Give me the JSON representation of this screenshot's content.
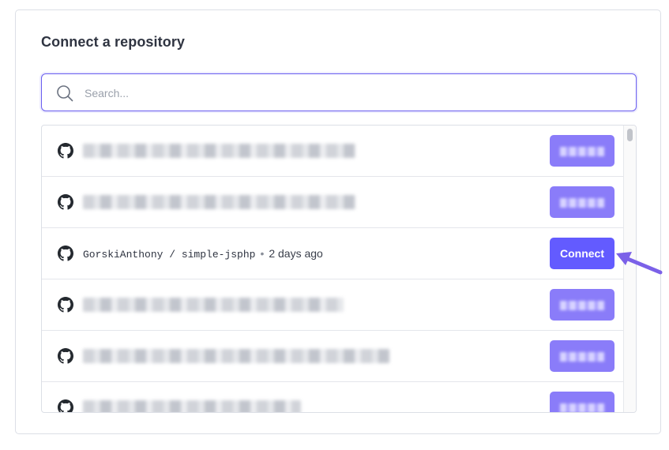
{
  "title": "Connect a repository",
  "search": {
    "placeholder": "Search...",
    "value": "",
    "icon": "search-icon"
  },
  "repositories": [
    {
      "visible": false,
      "button_label": ""
    },
    {
      "visible": false,
      "button_label": ""
    },
    {
      "visible": true,
      "name": "GorskiAnthony / simple-jsphp",
      "separator": "•",
      "updated": "2 days ago",
      "button_label": "Connect"
    },
    {
      "visible": false,
      "button_label": ""
    },
    {
      "visible": false,
      "button_label": ""
    },
    {
      "visible": false,
      "button_label": ""
    }
  ],
  "colors": {
    "accent": "#635bff",
    "annotation_arrow": "#7b61e8",
    "border": "#dcdfe6"
  },
  "icons": {
    "repo_icon": "github-icon",
    "annotation": "arrow-icon"
  }
}
